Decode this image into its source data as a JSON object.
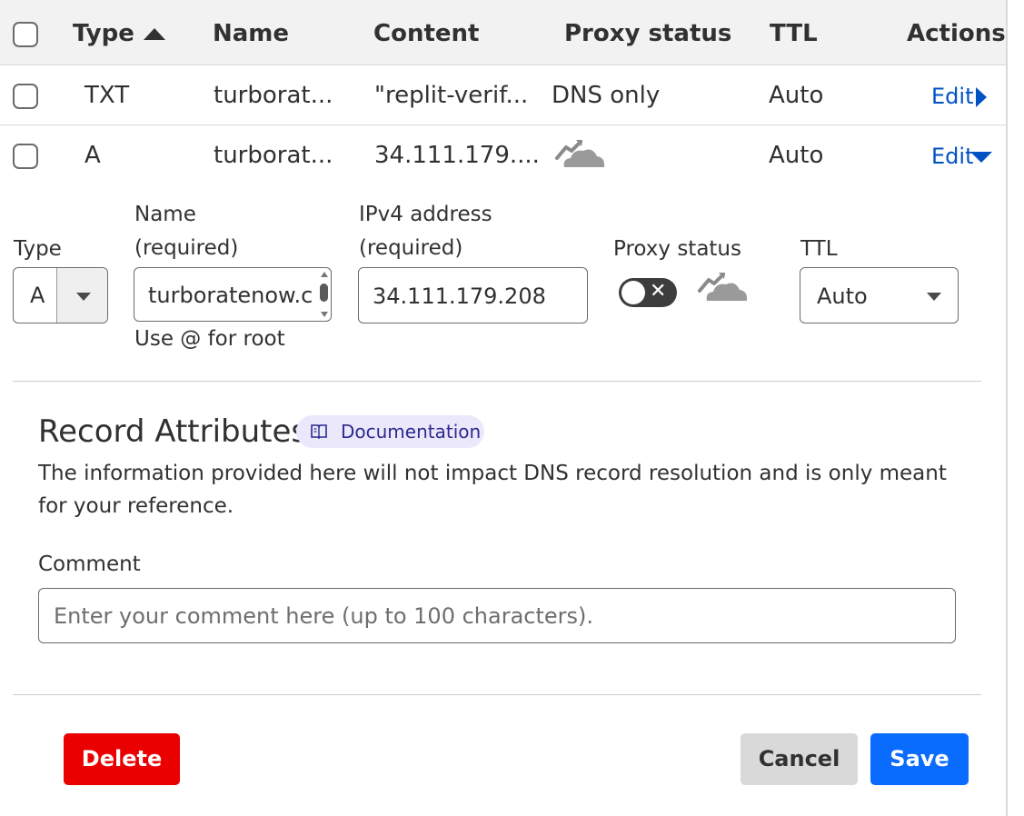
{
  "header": {
    "type": "Type",
    "name": "Name",
    "content": "Content",
    "proxy_status": "Proxy status",
    "ttl": "TTL",
    "actions": "Actions"
  },
  "rows": [
    {
      "type": "TXT",
      "name": "turborat...",
      "content": "\"replit-verif...",
      "proxy": "DNS only",
      "ttl": "Auto",
      "action": "Edit"
    },
    {
      "type": "A",
      "name": "turborat...",
      "content": "34.111.179....",
      "proxy_icon": "proxied-cloud-icon",
      "ttl": "Auto",
      "action": "Edit"
    }
  ],
  "form": {
    "type_label": "Type",
    "type_value": "A",
    "name_label_line1": "Name",
    "name_label_line2": "(required)",
    "name_value": "turboratenow.c",
    "name_hint": "Use @ for root",
    "ip_label_line1": "IPv4 address",
    "ip_label_line2": "(required)",
    "ip_value": "34.111.179.208",
    "proxy_label": "Proxy status",
    "proxy_enabled": false,
    "ttl_label": "TTL",
    "ttl_value": "Auto"
  },
  "attributes": {
    "title": "Record Attributes",
    "doc_label": "Documentation",
    "description": "The information provided here will not impact DNS record resolution and is only meant for your reference.",
    "comment_label": "Comment",
    "comment_placeholder": "Enter your comment here (up to 100 characters)."
  },
  "buttons": {
    "delete": "Delete",
    "cancel": "Cancel",
    "save": "Save"
  },
  "colors": {
    "link": "#0051c3",
    "delete": "#ea0000",
    "save": "#0a6bff",
    "cloud_gray": "#9a9a9a"
  }
}
